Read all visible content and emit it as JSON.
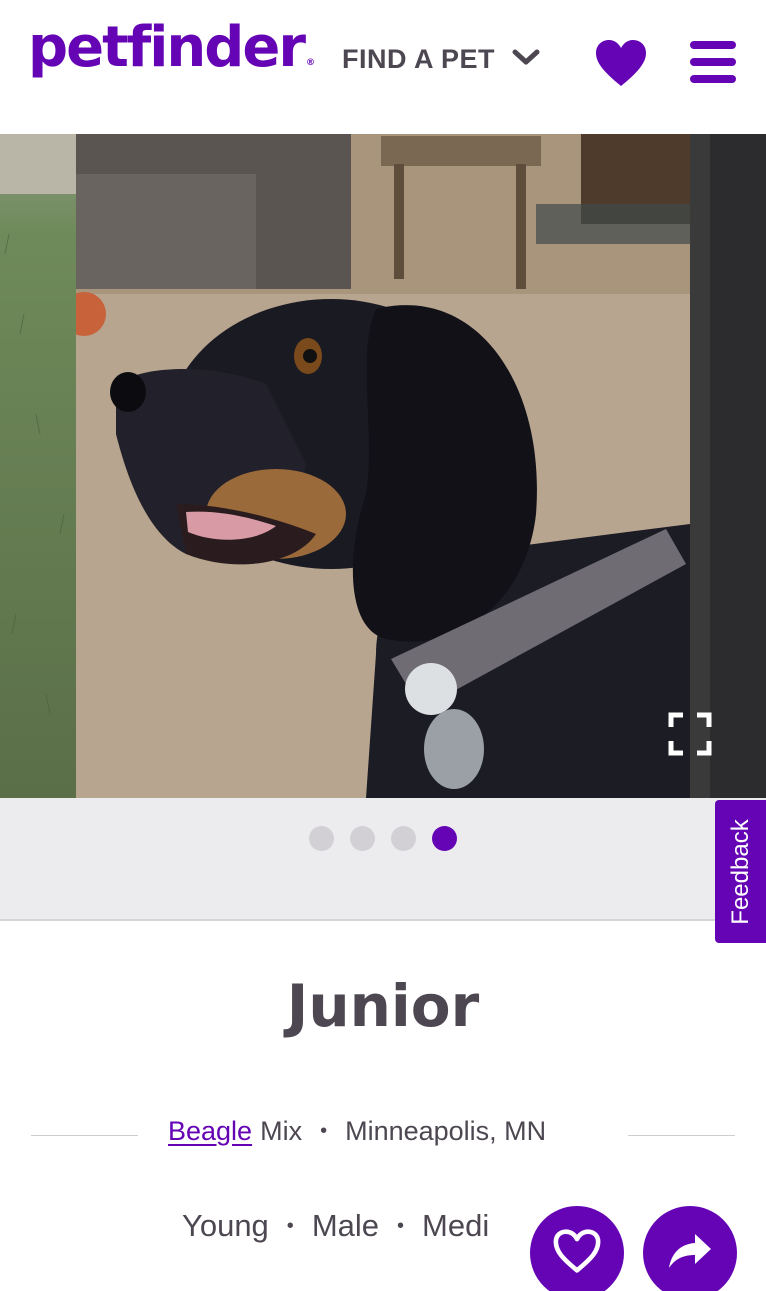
{
  "header": {
    "logo_text": "petfinder",
    "logo_mark": "®",
    "find_pet_label": "FIND A PET",
    "find_pet_icon": "chevron-down-icon",
    "favorites_icon": "heart-icon",
    "menu_icon": "hamburger-menu-icon",
    "brand_color": "#6504b5"
  },
  "carousel": {
    "photo_count": 4,
    "active_index": 3,
    "expand_icon": "fullscreen-icon"
  },
  "feedback": {
    "label": "Feedback"
  },
  "pet": {
    "name": "Junior",
    "breed": "Beagle",
    "breed_suffix": "Mix",
    "location": "Minneapolis, MN",
    "age": "Young",
    "gender": "Male",
    "size_partial": "Medi",
    "separator": "•"
  },
  "actions": {
    "favorite_icon": "heart-outline-icon",
    "share_icon": "share-arrow-icon"
  }
}
